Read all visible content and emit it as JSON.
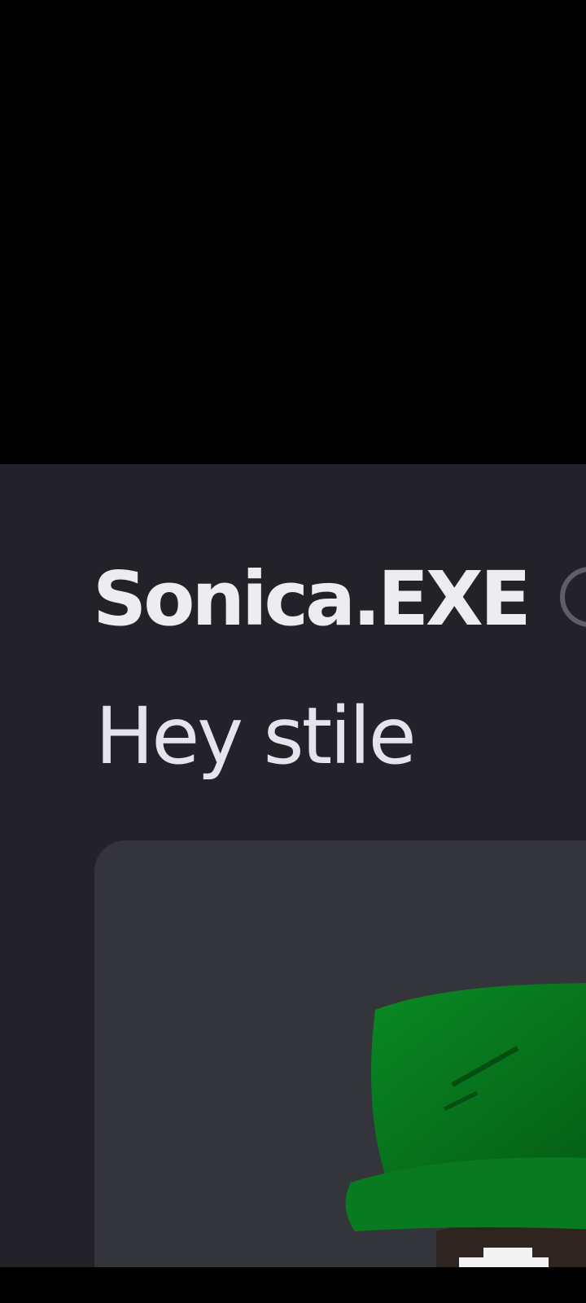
{
  "message": {
    "author": "Sonica.EXE",
    "text": "Hey stile"
  },
  "attachment": {
    "kind": "image",
    "subject_icon": "green-hat-icon"
  },
  "colors": {
    "chat_background": "#232229",
    "embed_background": "#33353b",
    "author_text": "#ececf1",
    "message_text": "#e4e4ea",
    "hat_green": "#0b7a1f"
  }
}
